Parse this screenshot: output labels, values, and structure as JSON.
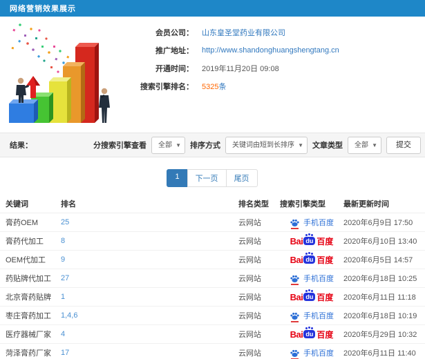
{
  "colors": {
    "header-bg": "#1e87c8",
    "link": "#3178be",
    "highlight": "#ff6600",
    "page-active": "#337ab7",
    "baidu-red": "#e60012",
    "baidu-blue": "#2534dc",
    "mobile-blue": "#2c6fd6"
  },
  "header": {
    "title": "网络营销效果展示"
  },
  "info": {
    "rows": [
      {
        "label": "会员公司：",
        "value": "山东皇圣堂药业有限公司"
      },
      {
        "label": "推广地址：",
        "value": "http://www.shandonghuangshengtang.cn"
      },
      {
        "label": "开通时间：",
        "value": "2019年11月20日 09:08"
      },
      {
        "label": "搜索引擎排名：",
        "value_num": "5325",
        "value_unit": "条"
      }
    ]
  },
  "filter": {
    "result_label": "结果：",
    "engine_label": "分搜索引擎查看",
    "engine_value": "全部",
    "sort_label": "排序方式",
    "sort_value": "关键词由短到长排序",
    "article_label": "文章类型",
    "article_value": "全部",
    "submit_label": "提交",
    "caret": "▼"
  },
  "pagination": {
    "current": "1",
    "next": "下一页",
    "last": "尾页"
  },
  "table": {
    "headers": [
      "关键词",
      "排名",
      "排名类型",
      "搜索引擎类型",
      "最新更新时间"
    ],
    "rows": [
      {
        "keyword": "膏药OEM",
        "rank": "25",
        "rank_type": "云网站",
        "engine": "mobile",
        "engine_label": "手机百度",
        "updated": "2020年6月9日 17:50"
      },
      {
        "keyword": "膏药代加工",
        "rank": "8",
        "rank_type": "云网站",
        "engine": "pc",
        "engine_label": "百度",
        "updated": "2020年6月10日 13:40"
      },
      {
        "keyword": "OEM代加工",
        "rank": "9",
        "rank_type": "云网站",
        "engine": "pc",
        "engine_label": "百度",
        "updated": "2020年6月5日 14:57"
      },
      {
        "keyword": "药贴牌代加工",
        "rank": "27",
        "rank_type": "云网站",
        "engine": "mobile",
        "engine_label": "手机百度",
        "updated": "2020年6月18日 10:25"
      },
      {
        "keyword": "北京膏药贴牌",
        "rank": "1",
        "rank_type": "云网站",
        "engine": "pc",
        "engine_label": "百度",
        "updated": "2020年6月11日 11:18"
      },
      {
        "keyword": "枣庄膏药加工",
        "rank": "1,4,6",
        "rank_type": "云网站",
        "engine": "mobile",
        "engine_label": "手机百度",
        "updated": "2020年6月18日 10:19"
      },
      {
        "keyword": "医疗器械厂家",
        "rank": "4",
        "rank_type": "云网站",
        "engine": "pc",
        "engine_label": "百度",
        "updated": "2020年5月29日 10:32"
      },
      {
        "keyword": "菏泽膏药厂家",
        "rank": "17",
        "rank_type": "云网站",
        "engine": "mobile",
        "engine_label": "手机百度",
        "updated": "2020年6月11日 11:40"
      }
    ]
  }
}
